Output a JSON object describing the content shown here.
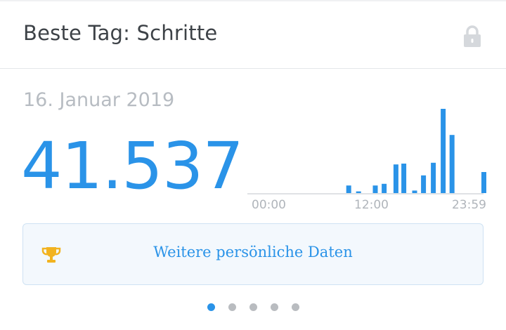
{
  "header": {
    "title": "Beste Tag: Schritte",
    "lock_icon": "lock-icon"
  },
  "stats": {
    "date": "16. Januar 2019",
    "steps": "41.537"
  },
  "colors": {
    "accent": "#2a93e8",
    "muted_text": "#b7bcc2",
    "title_text": "#3d4247",
    "trophy": "#f2b320"
  },
  "chart_data": {
    "type": "bar",
    "x_tick_labels": [
      "00:00",
      "12:00",
      "23:59"
    ],
    "x_range_hours": [
      0,
      24
    ],
    "bars": [
      {
        "hour": 10.3,
        "value": 0.09
      },
      {
        "hour": 11.3,
        "value": 0.02
      },
      {
        "hour": 13.0,
        "value": 0.09
      },
      {
        "hour": 13.9,
        "value": 0.11
      },
      {
        "hour": 15.1,
        "value": 0.34
      },
      {
        "hour": 15.9,
        "value": 0.35
      },
      {
        "hour": 17.0,
        "value": 0.03
      },
      {
        "hour": 17.9,
        "value": 0.21
      },
      {
        "hour": 18.9,
        "value": 0.36
      },
      {
        "hour": 19.9,
        "value": 1.0
      },
      {
        "hour": 20.8,
        "value": 0.69
      },
      {
        "hour": 23.9,
        "value": 0.25
      }
    ]
  },
  "more_button": {
    "label": "Weitere persönliche Daten",
    "icon": "trophy-icon"
  },
  "pager": {
    "count": 5,
    "active_index": 0
  }
}
